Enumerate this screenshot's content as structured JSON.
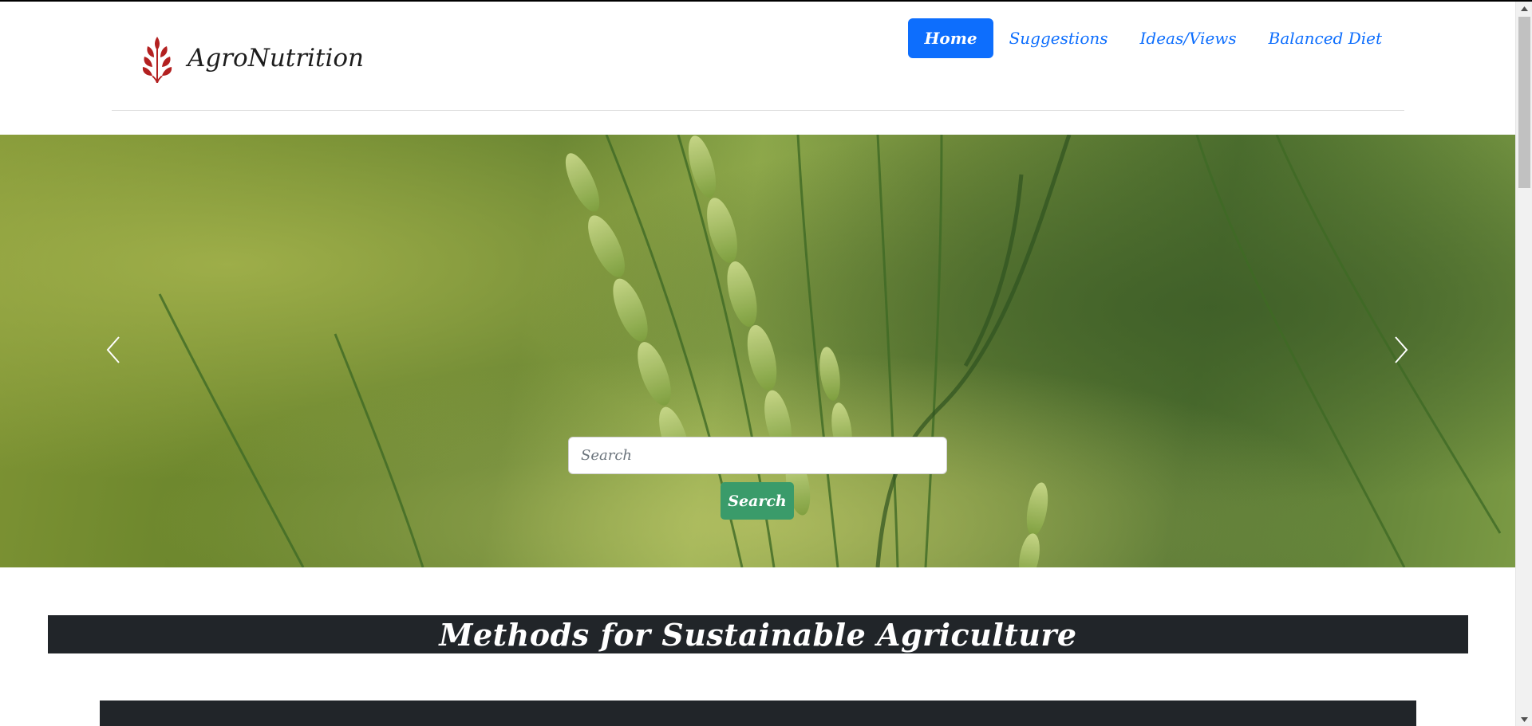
{
  "brand": {
    "name": "AgroNutrition",
    "logo_icon": "wheat-icon",
    "logo_color": "#b32020"
  },
  "nav": {
    "items": [
      {
        "label": "Home",
        "active": true
      },
      {
        "label": "Suggestions",
        "active": false
      },
      {
        "label": "Ideas/Views",
        "active": false
      },
      {
        "label": "Balanced Diet",
        "active": false
      }
    ],
    "accent": "#0d6efd"
  },
  "carousel": {
    "prev_icon": "chevron-left-icon",
    "next_icon": "chevron-right-icon",
    "slide_count": 3,
    "active_slide": 1
  },
  "search": {
    "placeholder": "Search",
    "value": "",
    "button_label": "Search",
    "button_color": "#3a9b6a"
  },
  "section": {
    "heading": "Methods for Sustainable Agriculture",
    "background": "#212529"
  }
}
